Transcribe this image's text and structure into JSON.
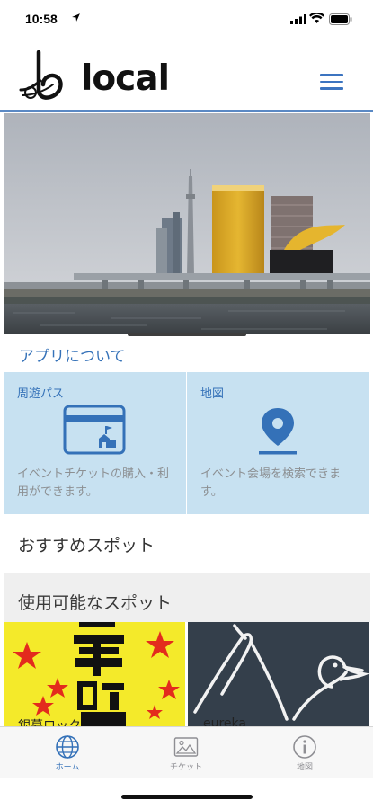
{
  "status_bar": {
    "time": "10:58"
  },
  "header": {
    "logo_text": "local"
  },
  "about": {
    "label": "アプリについて"
  },
  "cards": [
    {
      "title": "周遊パス",
      "description": "イベントチケットの購入・利用ができます。",
      "icon": "ticket-card-icon"
    },
    {
      "title": "地図",
      "description": "イベント会場を検索できます。",
      "icon": "map-pin-icon"
    }
  ],
  "sections": {
    "recommended": "おすすめスポット",
    "available": "使用可能なスポット"
  },
  "spots": [
    {
      "name": "銀幕ロック"
    },
    {
      "name": "eureka"
    }
  ],
  "tabs": [
    {
      "label": "ホーム",
      "icon": "globe-icon",
      "active": true
    },
    {
      "label": "チケット",
      "icon": "ticket-image-icon",
      "active": false
    },
    {
      "label": "地図",
      "icon": "info-icon",
      "active": false
    }
  ],
  "colors": {
    "accent": "#3471b8",
    "card_bg": "#c7e1f1",
    "header_rule": "#5a89c4"
  }
}
